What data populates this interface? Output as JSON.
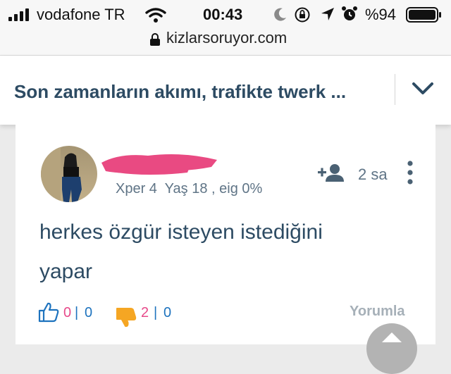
{
  "status_bar": {
    "carrier": "vodafone TR",
    "time": "00:43",
    "battery": "%94"
  },
  "url_bar": {
    "domain": "kizlarsoruyor.com"
  },
  "header": {
    "title": "Son zamanların akımı, trafikte twerk ..."
  },
  "answer": {
    "meta": "Xper 4  Yaş 18 , eig 0%",
    "time": "2 sa",
    "text_line1": "herkes özgür isteyen istediğini",
    "text_line2": "yapar",
    "likes": "0",
    "likes_sep": "|",
    "likes_extra": "0",
    "dislikes": "2",
    "dislikes_sep": "|",
    "dislikes_extra": "0",
    "comment_label": "Yorumla"
  },
  "colors": {
    "header_text": "#2d4b63",
    "meta_text": "#5f7486",
    "pink": "#e74a8a",
    "blue": "#1e73be",
    "orange": "#f5a623",
    "muted": "#a6b0b8"
  },
  "icons": [
    "signal-icon",
    "wifi-icon",
    "moon-icon",
    "rotation-lock-icon",
    "location-icon",
    "alarm-icon",
    "battery-icon",
    "lock-icon",
    "chevron-down-icon",
    "avatar",
    "add-friend-icon",
    "more-options-icon",
    "like-icon",
    "dislike-icon",
    "scroll-up-icon"
  ]
}
